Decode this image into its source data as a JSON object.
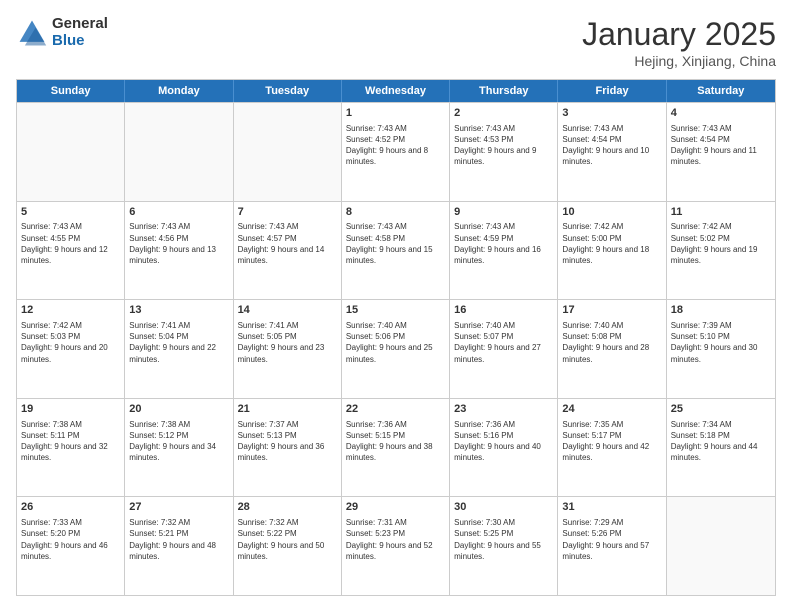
{
  "logo": {
    "general": "General",
    "blue": "Blue"
  },
  "title": "January 2025",
  "location": "Hejing, Xinjiang, China",
  "days": [
    "Sunday",
    "Monday",
    "Tuesday",
    "Wednesday",
    "Thursday",
    "Friday",
    "Saturday"
  ],
  "weeks": [
    [
      {
        "day": "",
        "sunrise": "",
        "sunset": "",
        "daylight": "",
        "empty": true
      },
      {
        "day": "",
        "sunrise": "",
        "sunset": "",
        "daylight": "",
        "empty": true
      },
      {
        "day": "",
        "sunrise": "",
        "sunset": "",
        "daylight": "",
        "empty": true
      },
      {
        "day": "1",
        "sunrise": "Sunrise: 7:43 AM",
        "sunset": "Sunset: 4:52 PM",
        "daylight": "Daylight: 9 hours and 8 minutes."
      },
      {
        "day": "2",
        "sunrise": "Sunrise: 7:43 AM",
        "sunset": "Sunset: 4:53 PM",
        "daylight": "Daylight: 9 hours and 9 minutes."
      },
      {
        "day": "3",
        "sunrise": "Sunrise: 7:43 AM",
        "sunset": "Sunset: 4:54 PM",
        "daylight": "Daylight: 9 hours and 10 minutes."
      },
      {
        "day": "4",
        "sunrise": "Sunrise: 7:43 AM",
        "sunset": "Sunset: 4:54 PM",
        "daylight": "Daylight: 9 hours and 11 minutes."
      }
    ],
    [
      {
        "day": "5",
        "sunrise": "Sunrise: 7:43 AM",
        "sunset": "Sunset: 4:55 PM",
        "daylight": "Daylight: 9 hours and 12 minutes."
      },
      {
        "day": "6",
        "sunrise": "Sunrise: 7:43 AM",
        "sunset": "Sunset: 4:56 PM",
        "daylight": "Daylight: 9 hours and 13 minutes."
      },
      {
        "day": "7",
        "sunrise": "Sunrise: 7:43 AM",
        "sunset": "Sunset: 4:57 PM",
        "daylight": "Daylight: 9 hours and 14 minutes."
      },
      {
        "day": "8",
        "sunrise": "Sunrise: 7:43 AM",
        "sunset": "Sunset: 4:58 PM",
        "daylight": "Daylight: 9 hours and 15 minutes."
      },
      {
        "day": "9",
        "sunrise": "Sunrise: 7:43 AM",
        "sunset": "Sunset: 4:59 PM",
        "daylight": "Daylight: 9 hours and 16 minutes."
      },
      {
        "day": "10",
        "sunrise": "Sunrise: 7:42 AM",
        "sunset": "Sunset: 5:00 PM",
        "daylight": "Daylight: 9 hours and 18 minutes."
      },
      {
        "day": "11",
        "sunrise": "Sunrise: 7:42 AM",
        "sunset": "Sunset: 5:02 PM",
        "daylight": "Daylight: 9 hours and 19 minutes."
      }
    ],
    [
      {
        "day": "12",
        "sunrise": "Sunrise: 7:42 AM",
        "sunset": "Sunset: 5:03 PM",
        "daylight": "Daylight: 9 hours and 20 minutes."
      },
      {
        "day": "13",
        "sunrise": "Sunrise: 7:41 AM",
        "sunset": "Sunset: 5:04 PM",
        "daylight": "Daylight: 9 hours and 22 minutes."
      },
      {
        "day": "14",
        "sunrise": "Sunrise: 7:41 AM",
        "sunset": "Sunset: 5:05 PM",
        "daylight": "Daylight: 9 hours and 23 minutes."
      },
      {
        "day": "15",
        "sunrise": "Sunrise: 7:40 AM",
        "sunset": "Sunset: 5:06 PM",
        "daylight": "Daylight: 9 hours and 25 minutes."
      },
      {
        "day": "16",
        "sunrise": "Sunrise: 7:40 AM",
        "sunset": "Sunset: 5:07 PM",
        "daylight": "Daylight: 9 hours and 27 minutes."
      },
      {
        "day": "17",
        "sunrise": "Sunrise: 7:40 AM",
        "sunset": "Sunset: 5:08 PM",
        "daylight": "Daylight: 9 hours and 28 minutes."
      },
      {
        "day": "18",
        "sunrise": "Sunrise: 7:39 AM",
        "sunset": "Sunset: 5:10 PM",
        "daylight": "Daylight: 9 hours and 30 minutes."
      }
    ],
    [
      {
        "day": "19",
        "sunrise": "Sunrise: 7:38 AM",
        "sunset": "Sunset: 5:11 PM",
        "daylight": "Daylight: 9 hours and 32 minutes."
      },
      {
        "day": "20",
        "sunrise": "Sunrise: 7:38 AM",
        "sunset": "Sunset: 5:12 PM",
        "daylight": "Daylight: 9 hours and 34 minutes."
      },
      {
        "day": "21",
        "sunrise": "Sunrise: 7:37 AM",
        "sunset": "Sunset: 5:13 PM",
        "daylight": "Daylight: 9 hours and 36 minutes."
      },
      {
        "day": "22",
        "sunrise": "Sunrise: 7:36 AM",
        "sunset": "Sunset: 5:15 PM",
        "daylight": "Daylight: 9 hours and 38 minutes."
      },
      {
        "day": "23",
        "sunrise": "Sunrise: 7:36 AM",
        "sunset": "Sunset: 5:16 PM",
        "daylight": "Daylight: 9 hours and 40 minutes."
      },
      {
        "day": "24",
        "sunrise": "Sunrise: 7:35 AM",
        "sunset": "Sunset: 5:17 PM",
        "daylight": "Daylight: 9 hours and 42 minutes."
      },
      {
        "day": "25",
        "sunrise": "Sunrise: 7:34 AM",
        "sunset": "Sunset: 5:18 PM",
        "daylight": "Daylight: 9 hours and 44 minutes."
      }
    ],
    [
      {
        "day": "26",
        "sunrise": "Sunrise: 7:33 AM",
        "sunset": "Sunset: 5:20 PM",
        "daylight": "Daylight: 9 hours and 46 minutes."
      },
      {
        "day": "27",
        "sunrise": "Sunrise: 7:32 AM",
        "sunset": "Sunset: 5:21 PM",
        "daylight": "Daylight: 9 hours and 48 minutes."
      },
      {
        "day": "28",
        "sunrise": "Sunrise: 7:32 AM",
        "sunset": "Sunset: 5:22 PM",
        "daylight": "Daylight: 9 hours and 50 minutes."
      },
      {
        "day": "29",
        "sunrise": "Sunrise: 7:31 AM",
        "sunset": "Sunset: 5:23 PM",
        "daylight": "Daylight: 9 hours and 52 minutes."
      },
      {
        "day": "30",
        "sunrise": "Sunrise: 7:30 AM",
        "sunset": "Sunset: 5:25 PM",
        "daylight": "Daylight: 9 hours and 55 minutes."
      },
      {
        "day": "31",
        "sunrise": "Sunrise: 7:29 AM",
        "sunset": "Sunset: 5:26 PM",
        "daylight": "Daylight: 9 hours and 57 minutes."
      },
      {
        "day": "",
        "sunrise": "",
        "sunset": "",
        "daylight": "",
        "empty": true
      }
    ]
  ]
}
